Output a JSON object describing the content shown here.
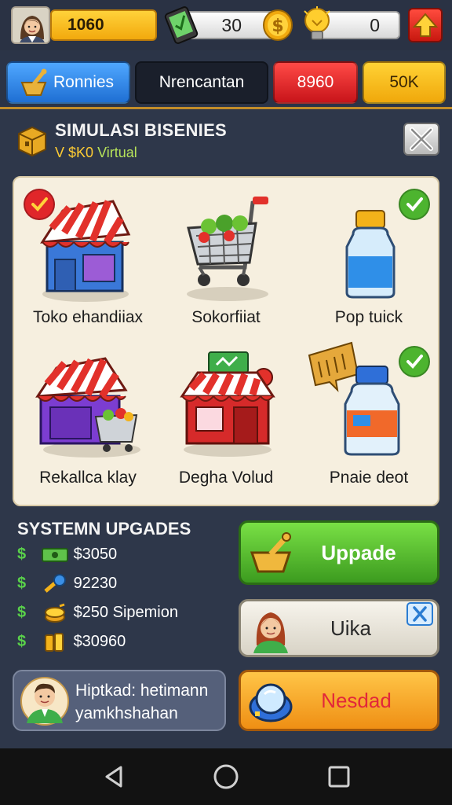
{
  "status_bar": {
    "level_value": "1060",
    "cash_value": "30",
    "ideas_value": "0"
  },
  "tabs": [
    {
      "label": "Ronnies"
    },
    {
      "label": "Nrencantan"
    },
    {
      "label": "8960"
    },
    {
      "label": "50K"
    }
  ],
  "simulation": {
    "title": "SIMULASI BISENIES",
    "subtitle_amount": "V $K0",
    "subtitle_suffix": "Virtual"
  },
  "businesses": [
    {
      "label": "Toko ehandiiax",
      "check": "red"
    },
    {
      "label": "Sokorfiiat",
      "check": "none"
    },
    {
      "label": "Pop tuick",
      "check": "green"
    },
    {
      "label": "Rekallca klay",
      "check": "none"
    },
    {
      "label": "Degha Volud",
      "check": "none"
    },
    {
      "label": "Pnaie deot",
      "check": "green"
    }
  ],
  "upgrades": {
    "title": "SYSTEMN UPGADES",
    "currency_symbol": "$",
    "items": [
      {
        "icon": "cash-bill-icon",
        "label": "$3050"
      },
      {
        "icon": "wrench-icon",
        "label": "92230"
      },
      {
        "icon": "coin-stack-icon",
        "label": "$250 Sipemion"
      },
      {
        "icon": "gold-bars-icon",
        "label": "$30960"
      }
    ]
  },
  "buttons": {
    "upgrade_label": "Uppade",
    "uika_label": "Uika",
    "nesdad_label": "Nesdad"
  },
  "message": {
    "line1": "Hiptkad: hetimann",
    "line2": "yamkhshahan"
  },
  "colors": {
    "background": "#2b3447",
    "accent_gold": "#f2a90d",
    "upgrade_green": "#4fbf2a",
    "danger_red": "#e0262a"
  }
}
